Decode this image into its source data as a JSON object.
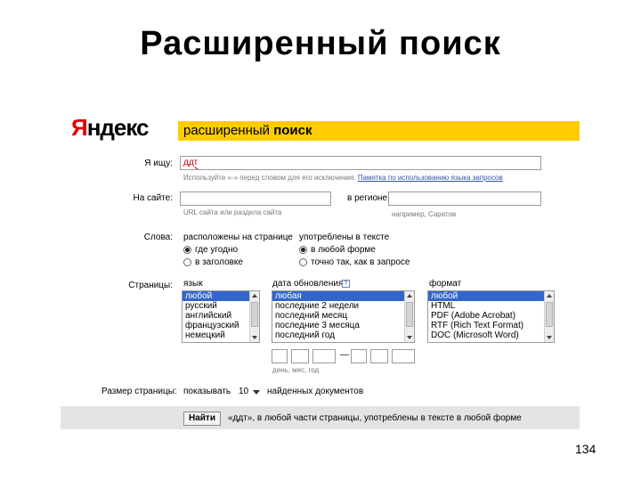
{
  "slide": {
    "title": "Расширенный поиск",
    "page_number": "134"
  },
  "logo": {
    "first": "Я",
    "rest": "ндекс"
  },
  "banner": {
    "prefix": "расширенный ",
    "strong": "поиск"
  },
  "query": {
    "label": "Я ищу:",
    "value": "ддт",
    "hint": "Используйте «-» перед словом для его исключения.",
    "hint_link": "Памятка по использованию языка запросов"
  },
  "site": {
    "label": "На сайте:",
    "hint": "URL сайта или раздела сайта"
  },
  "region": {
    "label": "в регионе",
    "hint": "например, Саратов"
  },
  "words": {
    "label": "Слова:",
    "placement_title": "расположены на странице",
    "placement_options": [
      "где угодно",
      "в заголовке"
    ],
    "form_title": "употреблены в тексте",
    "form_options": [
      "в любой форме",
      "точно так, как в запросе"
    ]
  },
  "pages": {
    "label": "Страницы:",
    "lang_title": "язык",
    "lang_options": [
      "любой",
      "русский",
      "английский",
      "французский",
      "немецкий"
    ],
    "date_title": "дата обновления",
    "date_icon": "?",
    "date_options": [
      "любая",
      "последние 2 недели",
      "последний месяц",
      "последние 3 месяца",
      "последний год"
    ],
    "format_title": "формат",
    "format_options": [
      "HTML",
      "PDF (Adobe Acrobat)",
      "RTF (Rich Text Format)",
      "DOC (Microsoft Word)"
    ],
    "format_selected": "любой",
    "date_dash": "—",
    "date_hint": "день, мес, год"
  },
  "page_size": {
    "label": "Размер страницы:",
    "prefix": "показывать",
    "value": "10",
    "suffix": "найденных документов"
  },
  "bottom": {
    "button": "Найти",
    "summary": "«ддт», в любой части страницы, употреблены в тексте в любой форме"
  }
}
